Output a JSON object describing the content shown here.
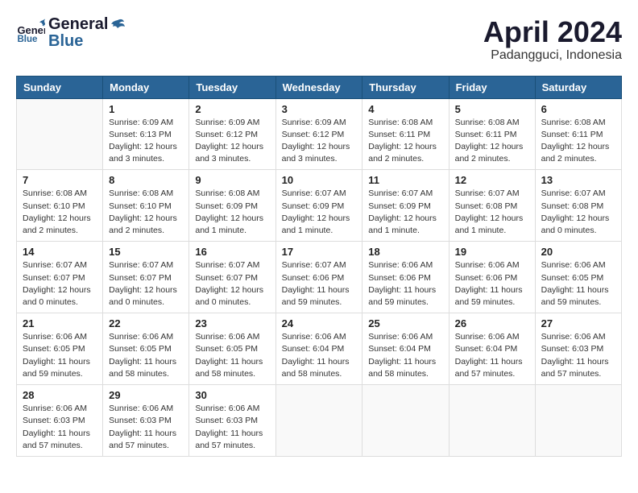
{
  "header": {
    "logo_general": "General",
    "logo_blue": "Blue",
    "month": "April 2024",
    "location": "Padangguci, Indonesia"
  },
  "weekdays": [
    "Sunday",
    "Monday",
    "Tuesday",
    "Wednesday",
    "Thursday",
    "Friday",
    "Saturday"
  ],
  "weeks": [
    [
      {
        "day": "",
        "info": ""
      },
      {
        "day": "1",
        "info": "Sunrise: 6:09 AM\nSunset: 6:13 PM\nDaylight: 12 hours\nand 3 minutes."
      },
      {
        "day": "2",
        "info": "Sunrise: 6:09 AM\nSunset: 6:12 PM\nDaylight: 12 hours\nand 3 minutes."
      },
      {
        "day": "3",
        "info": "Sunrise: 6:09 AM\nSunset: 6:12 PM\nDaylight: 12 hours\nand 3 minutes."
      },
      {
        "day": "4",
        "info": "Sunrise: 6:08 AM\nSunset: 6:11 PM\nDaylight: 12 hours\nand 2 minutes."
      },
      {
        "day": "5",
        "info": "Sunrise: 6:08 AM\nSunset: 6:11 PM\nDaylight: 12 hours\nand 2 minutes."
      },
      {
        "day": "6",
        "info": "Sunrise: 6:08 AM\nSunset: 6:11 PM\nDaylight: 12 hours\nand 2 minutes."
      }
    ],
    [
      {
        "day": "7",
        "info": "Sunrise: 6:08 AM\nSunset: 6:10 PM\nDaylight: 12 hours\nand 2 minutes."
      },
      {
        "day": "8",
        "info": "Sunrise: 6:08 AM\nSunset: 6:10 PM\nDaylight: 12 hours\nand 2 minutes."
      },
      {
        "day": "9",
        "info": "Sunrise: 6:08 AM\nSunset: 6:09 PM\nDaylight: 12 hours\nand 1 minute."
      },
      {
        "day": "10",
        "info": "Sunrise: 6:07 AM\nSunset: 6:09 PM\nDaylight: 12 hours\nand 1 minute."
      },
      {
        "day": "11",
        "info": "Sunrise: 6:07 AM\nSunset: 6:09 PM\nDaylight: 12 hours\nand 1 minute."
      },
      {
        "day": "12",
        "info": "Sunrise: 6:07 AM\nSunset: 6:08 PM\nDaylight: 12 hours\nand 1 minute."
      },
      {
        "day": "13",
        "info": "Sunrise: 6:07 AM\nSunset: 6:08 PM\nDaylight: 12 hours\nand 0 minutes."
      }
    ],
    [
      {
        "day": "14",
        "info": "Sunrise: 6:07 AM\nSunset: 6:07 PM\nDaylight: 12 hours\nand 0 minutes."
      },
      {
        "day": "15",
        "info": "Sunrise: 6:07 AM\nSunset: 6:07 PM\nDaylight: 12 hours\nand 0 minutes."
      },
      {
        "day": "16",
        "info": "Sunrise: 6:07 AM\nSunset: 6:07 PM\nDaylight: 12 hours\nand 0 minutes."
      },
      {
        "day": "17",
        "info": "Sunrise: 6:07 AM\nSunset: 6:06 PM\nDaylight: 11 hours\nand 59 minutes."
      },
      {
        "day": "18",
        "info": "Sunrise: 6:06 AM\nSunset: 6:06 PM\nDaylight: 11 hours\nand 59 minutes."
      },
      {
        "day": "19",
        "info": "Sunrise: 6:06 AM\nSunset: 6:06 PM\nDaylight: 11 hours\nand 59 minutes."
      },
      {
        "day": "20",
        "info": "Sunrise: 6:06 AM\nSunset: 6:05 PM\nDaylight: 11 hours\nand 59 minutes."
      }
    ],
    [
      {
        "day": "21",
        "info": "Sunrise: 6:06 AM\nSunset: 6:05 PM\nDaylight: 11 hours\nand 59 minutes."
      },
      {
        "day": "22",
        "info": "Sunrise: 6:06 AM\nSunset: 6:05 PM\nDaylight: 11 hours\nand 58 minutes."
      },
      {
        "day": "23",
        "info": "Sunrise: 6:06 AM\nSunset: 6:05 PM\nDaylight: 11 hours\nand 58 minutes."
      },
      {
        "day": "24",
        "info": "Sunrise: 6:06 AM\nSunset: 6:04 PM\nDaylight: 11 hours\nand 58 minutes."
      },
      {
        "day": "25",
        "info": "Sunrise: 6:06 AM\nSunset: 6:04 PM\nDaylight: 11 hours\nand 58 minutes."
      },
      {
        "day": "26",
        "info": "Sunrise: 6:06 AM\nSunset: 6:04 PM\nDaylight: 11 hours\nand 57 minutes."
      },
      {
        "day": "27",
        "info": "Sunrise: 6:06 AM\nSunset: 6:03 PM\nDaylight: 11 hours\nand 57 minutes."
      }
    ],
    [
      {
        "day": "28",
        "info": "Sunrise: 6:06 AM\nSunset: 6:03 PM\nDaylight: 11 hours\nand 57 minutes."
      },
      {
        "day": "29",
        "info": "Sunrise: 6:06 AM\nSunset: 6:03 PM\nDaylight: 11 hours\nand 57 minutes."
      },
      {
        "day": "30",
        "info": "Sunrise: 6:06 AM\nSunset: 6:03 PM\nDaylight: 11 hours\nand 57 minutes."
      },
      {
        "day": "",
        "info": ""
      },
      {
        "day": "",
        "info": ""
      },
      {
        "day": "",
        "info": ""
      },
      {
        "day": "",
        "info": ""
      }
    ]
  ]
}
